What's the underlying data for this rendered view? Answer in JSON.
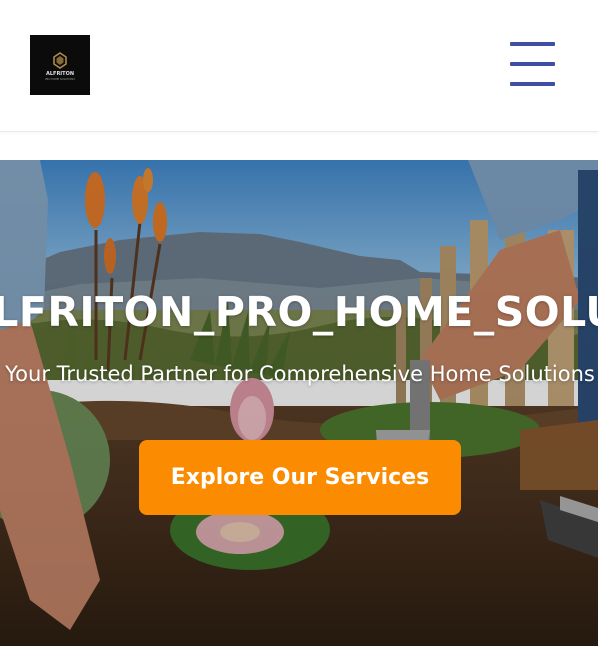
{
  "header": {
    "logo_text": "ALFRITON",
    "logo_subtext": "PRO HOME SOLUTIONS",
    "menu_icon": "hamburger-menu-icon",
    "menu_color": "#3f4ea6"
  },
  "hero": {
    "title": "ALFRITON_PRO_HOME_SOLUTIONS",
    "subtitle": "Your Trusted Partner for Comprehensive Home Solutions",
    "cta_label": "Explore Our Services",
    "cta_color": "#fb8b00",
    "background_image": "garden-landscaping-photo"
  }
}
